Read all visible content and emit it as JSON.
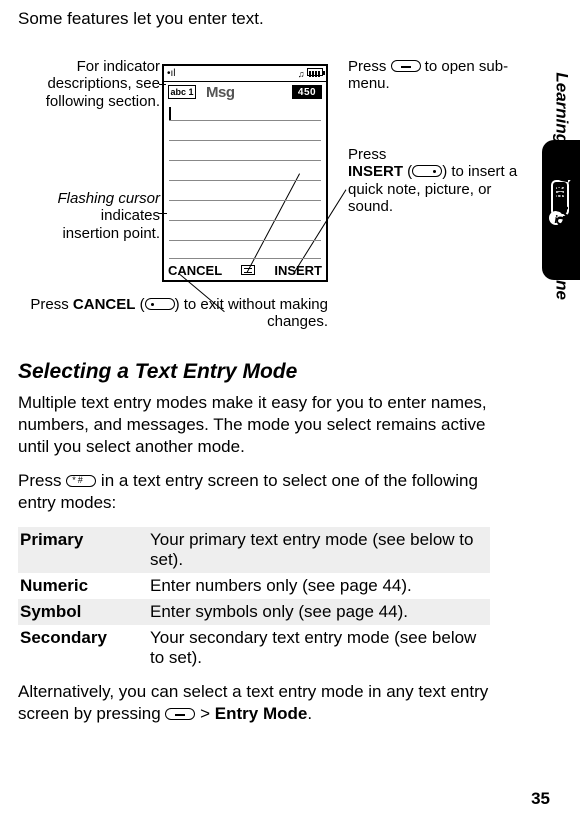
{
  "intro": "Some features let you enter text.",
  "callouts": {
    "indicators": "For indicator descriptions, see following section.",
    "cursor_pre": "Flashing cursor",
    "cursor_post": " indicates insertion point.",
    "open_pre": "Press ",
    "open_post": " to open sub-menu.",
    "insert_pre": "Press ",
    "insert_label": "INSERT",
    "insert_post1": " (",
    "insert_post2": ") to insert a quick note, picture, or sound.",
    "cancel_pre": "Press ",
    "cancel_label": "CANCEL",
    "cancel_post1": " (",
    "cancel_post2": ") to exit without making changes."
  },
  "screen": {
    "abc": "abc 1",
    "title": "Msg",
    "count": "450",
    "sk_left": "CANCEL",
    "sk_right": "INSERT"
  },
  "section_title": "Selecting a Text Entry Mode",
  "para1": "Multiple text entry modes make it easy for you to enter names, numbers, and messages. The mode you select remains active until you select another mode.",
  "para2_pre": "Press ",
  "para2_post": " in a text entry screen to select one of the following entry modes:",
  "table": [
    {
      "name": "Primary",
      "desc": "Your primary text entry mode (see below to set)."
    },
    {
      "name": "Numeric",
      "desc": "Enter numbers only (see page 44)."
    },
    {
      "name": "Symbol",
      "desc": "Enter symbols only (see page 44)."
    },
    {
      "name": "Secondary",
      "desc": "Your secondary text entry mode (see below to set)."
    }
  ],
  "para3_pre": "Alternatively, you can select a text entry mode in any text entry screen by pressing ",
  "para3_sep": " > ",
  "para3_menu": "Entry Mode",
  "para3_end": ".",
  "side_label": "Learning to Use Your Phone",
  "page_number": "35"
}
